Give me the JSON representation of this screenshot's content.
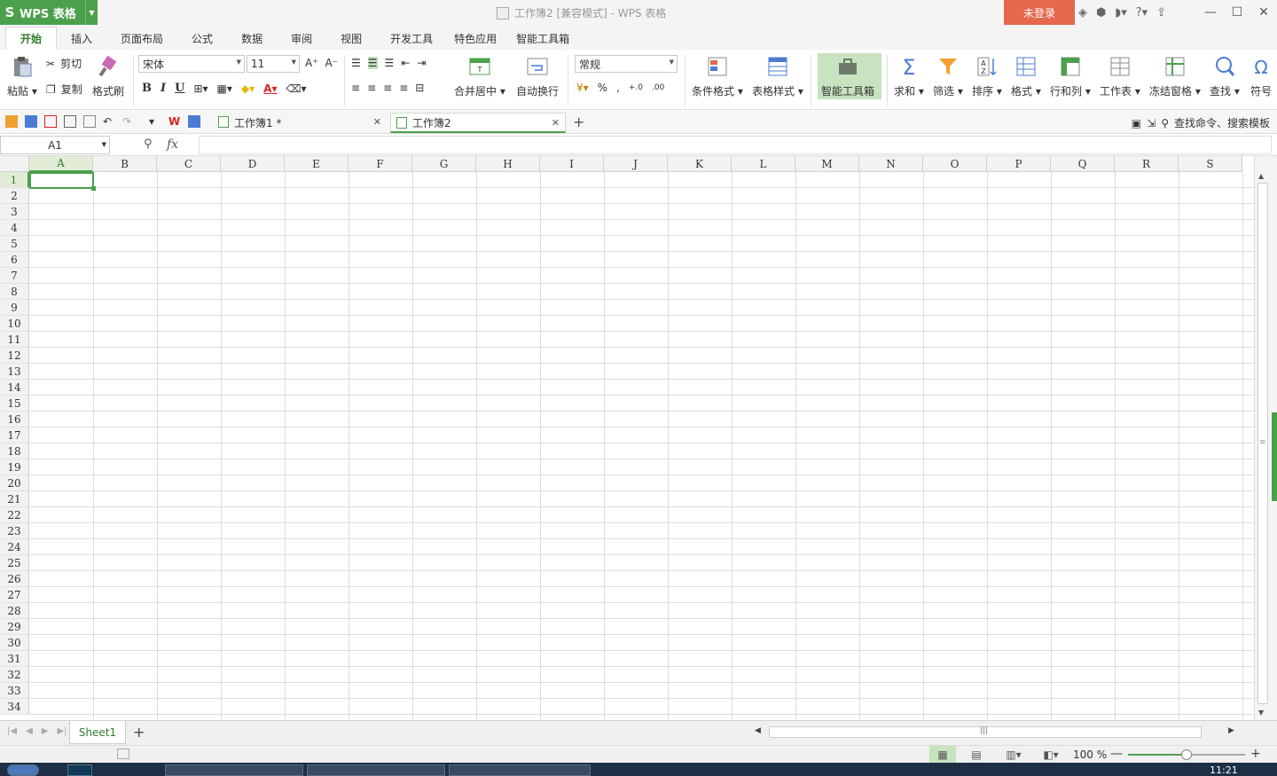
{
  "app": {
    "name": "WPS 表格",
    "window_title": "工作簿2 [兼容模式] - WPS 表格",
    "login_label": "未登录"
  },
  "menu": {
    "tabs": [
      "开始",
      "插入",
      "页面布局",
      "公式",
      "数据",
      "审阅",
      "视图",
      "开发工具",
      "特色应用",
      "智能工具箱"
    ],
    "active": "开始"
  },
  "ribbon": {
    "paste": "粘贴",
    "cut": "剪切",
    "copy": "复制",
    "format_painter": "格式刷",
    "font_name": "宋体",
    "font_size": "11",
    "bold": "B",
    "italic": "I",
    "underline": "U",
    "merge_center": "合并居中",
    "wrap_text": "自动换行",
    "number_format": "常规",
    "percent": "%",
    "comma": ",",
    "conditional_format": "条件格式",
    "table_style": "表格样式",
    "smart_toolbox": "智能工具箱",
    "sum": "求和",
    "filter": "筛选",
    "sort": "排序",
    "format": "格式",
    "rows_cols": "行和列",
    "worksheet": "工作表",
    "freeze": "冻结窗格",
    "find": "查找",
    "symbol": "符号"
  },
  "doc_tabs": [
    {
      "label": "工作簿1 *",
      "active": false
    },
    {
      "label": "工作簿2",
      "active": true
    }
  ],
  "search_cmd": "查找命令、搜索模板",
  "formula_bar": {
    "name_box": "A1",
    "fx": "fx",
    "value": ""
  },
  "grid": {
    "columns": [
      "A",
      "B",
      "C",
      "D",
      "E",
      "F",
      "G",
      "H",
      "I",
      "J",
      "K",
      "L",
      "M",
      "N",
      "O",
      "P",
      "Q",
      "R",
      "S"
    ],
    "rows": [
      "1",
      "2",
      "3",
      "4",
      "5",
      "6",
      "7",
      "8",
      "9",
      "10",
      "11",
      "12",
      "13",
      "14",
      "15",
      "16",
      "17",
      "18",
      "19",
      "20",
      "21",
      "22",
      "23",
      "24",
      "25",
      "26",
      "27",
      "28",
      "29",
      "30",
      "31",
      "32",
      "33",
      "34"
    ],
    "selected_cell": "A1"
  },
  "sheets": {
    "tabs": [
      "Sheet1"
    ],
    "active": "Sheet1"
  },
  "status": {
    "zoom": "100 %",
    "zoom_level_percent": 50
  },
  "taskbar": {
    "clock": "11:21"
  },
  "colors": {
    "accent": "#4ba04b",
    "login_bg": "#e5674d",
    "smart_bg": "#c7e3c0"
  }
}
